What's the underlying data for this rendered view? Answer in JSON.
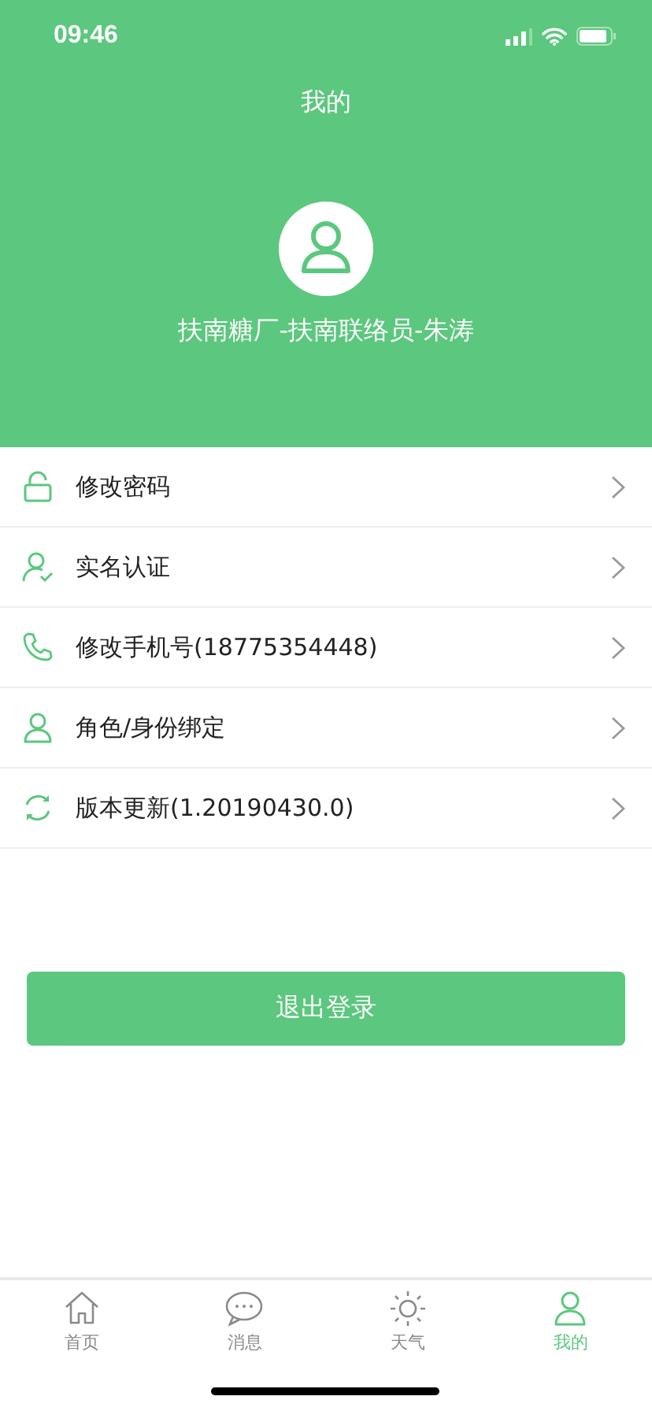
{
  "status_bar": {
    "time": "09:46"
  },
  "header": {
    "title": "我的",
    "user_name": "扶南糖厂-扶南联络员-朱涛"
  },
  "menu": [
    {
      "label": "修改密码"
    },
    {
      "label": "实名认证"
    },
    {
      "label": "修改手机号(18775354448)"
    },
    {
      "label": "角色/身份绑定"
    },
    {
      "label": "版本更新(1.20190430.0)"
    }
  ],
  "logout_button": "退出登录",
  "tabs": [
    {
      "label": "首页",
      "selected": false
    },
    {
      "label": "消息",
      "selected": false
    },
    {
      "label": "天气",
      "selected": false
    },
    {
      "label": "我的",
      "selected": true
    }
  ]
}
